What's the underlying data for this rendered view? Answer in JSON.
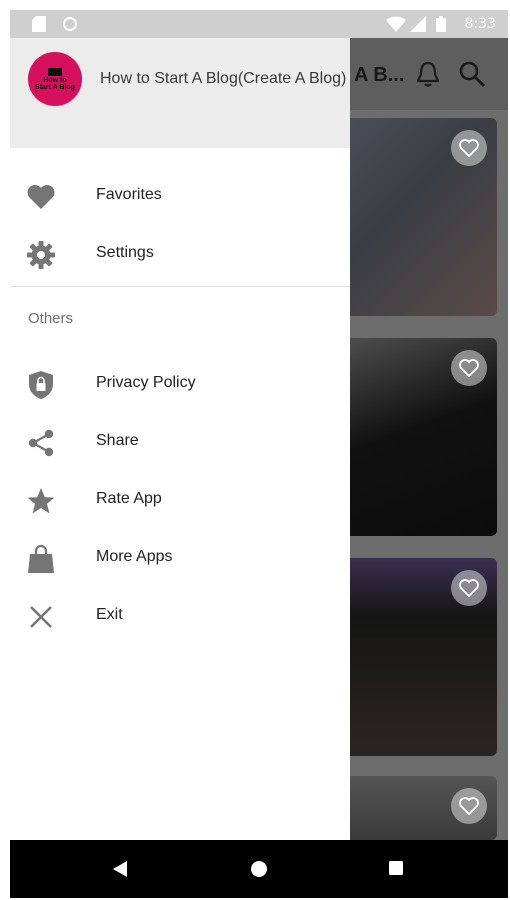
{
  "status_bar": {
    "time": "8:33"
  },
  "app": {
    "toolbar_title": "A B..."
  },
  "drawer": {
    "header_title": "How to Start A Blog(Create A Blog)",
    "logo_text": "How to Start A Blog",
    "primary_items": [
      {
        "label": "Favorites",
        "icon": "heart-icon"
      },
      {
        "label": "Settings",
        "icon": "gear-icon"
      }
    ],
    "section_label": "Others",
    "other_items": [
      {
        "label": "Privacy Policy",
        "icon": "shield-lock-icon"
      },
      {
        "label": "Share",
        "icon": "share-icon"
      },
      {
        "label": "Rate App",
        "icon": "star-icon"
      },
      {
        "label": "More Apps",
        "icon": "shopping-bag-icon"
      },
      {
        "label": "Exit",
        "icon": "close-icon"
      }
    ]
  },
  "colors": {
    "logo_background": "#d6105d",
    "icon_gray": "#757575",
    "scrim_gray": "#6a6a6a"
  }
}
